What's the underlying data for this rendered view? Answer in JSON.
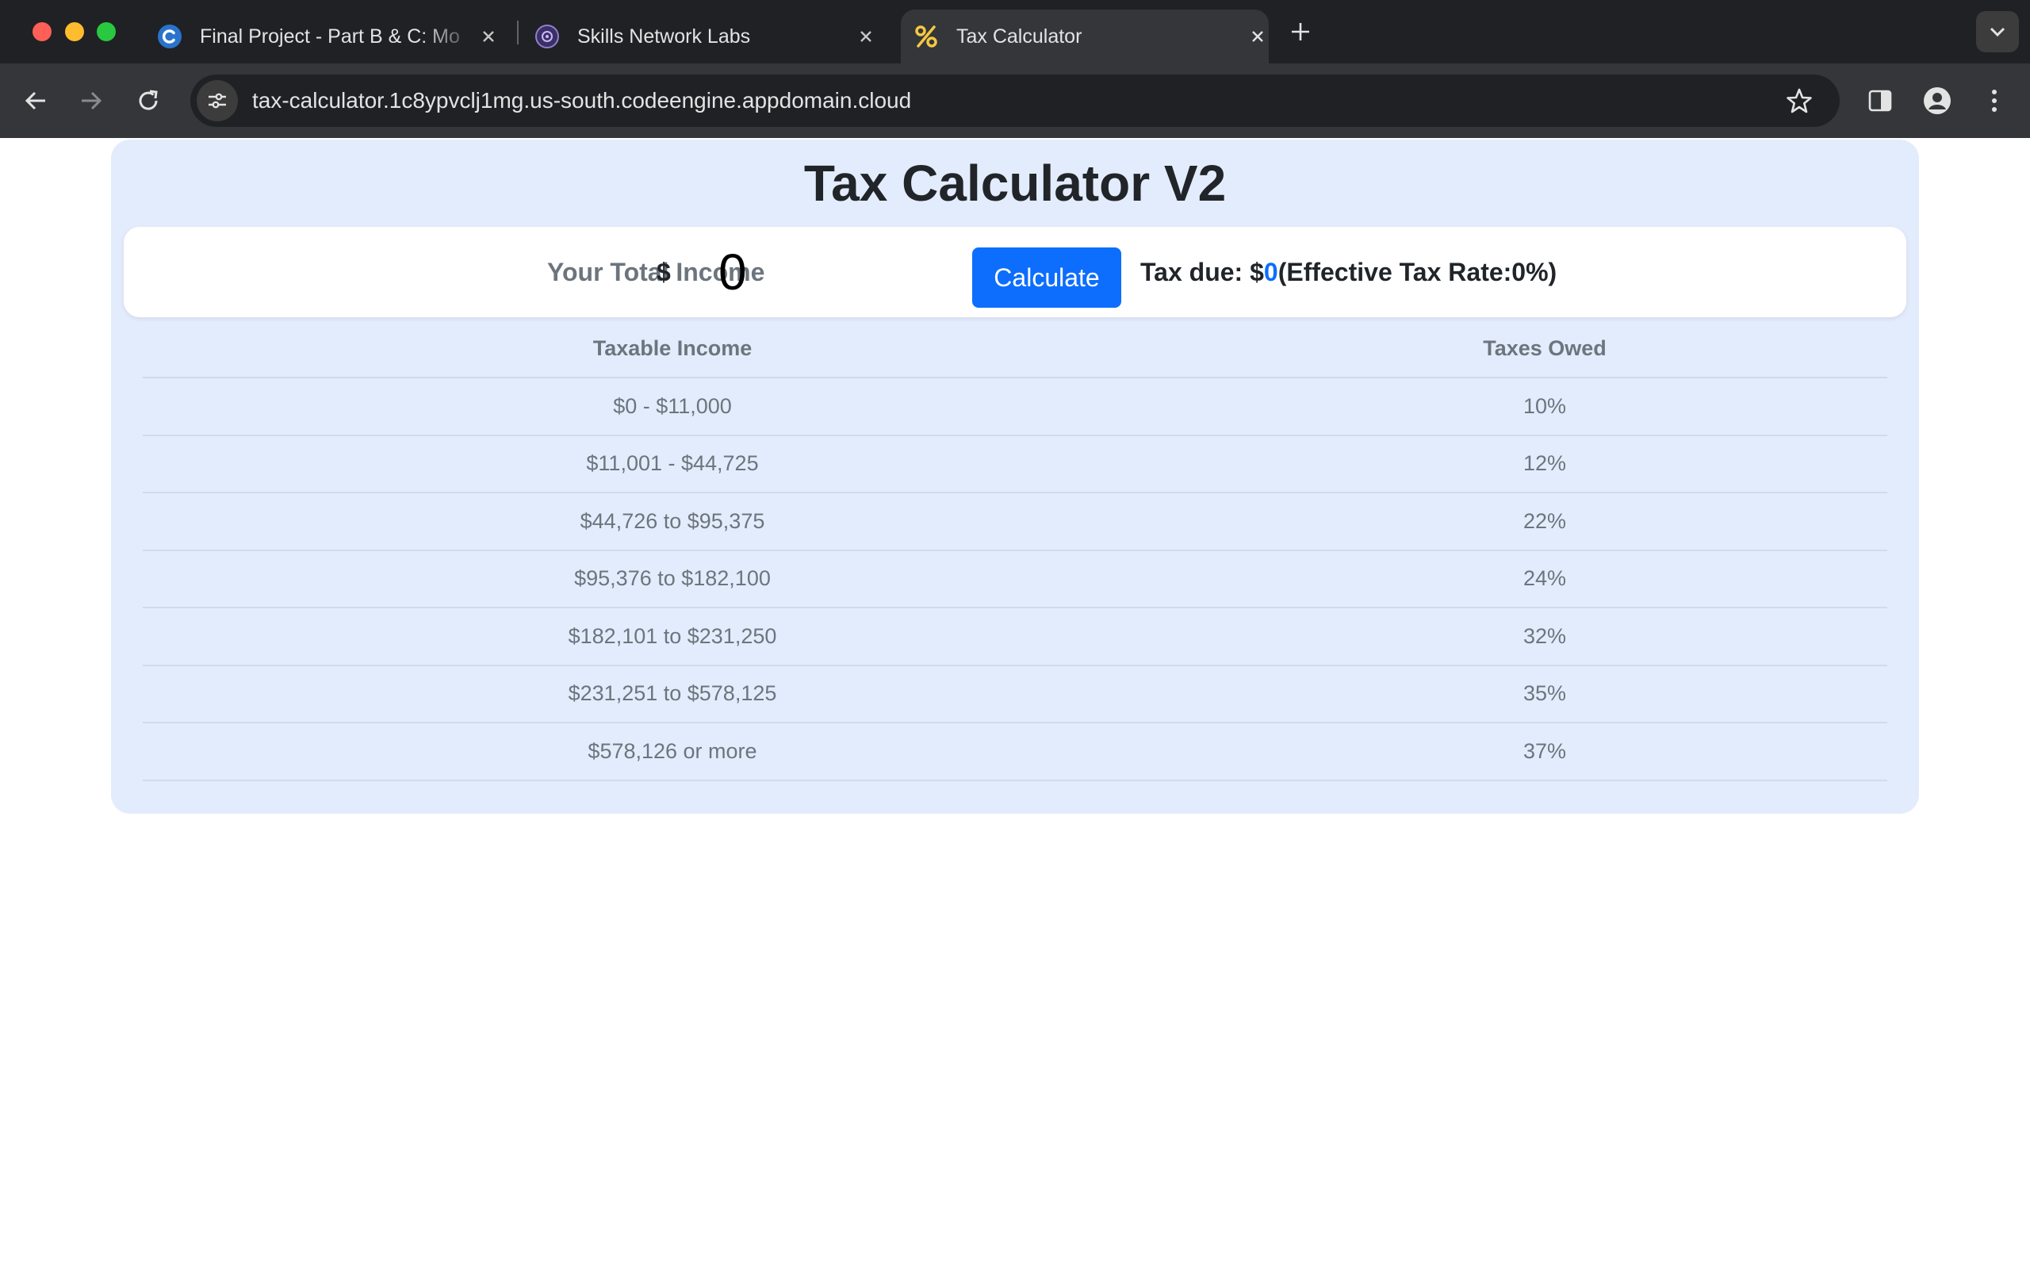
{
  "browser": {
    "tabs": [
      {
        "title": "Final Project - Part B & C: Mo",
        "active": false
      },
      {
        "title": "Skills Network Labs",
        "active": false
      },
      {
        "title": "Tax Calculator",
        "active": true
      }
    ],
    "url": "tax-calculator.1c8ypvclj1mg.us-south.codeengine.appdomain.cloud",
    "icons": [
      "back-icon",
      "forward-icon",
      "reload-icon",
      "site-info-icon",
      "star-icon",
      "side-panel-icon",
      "profile-icon",
      "menu-icon",
      "new-tab-icon",
      "tab-list-icon"
    ]
  },
  "app": {
    "title": "Tax Calculator V2",
    "income_label": "Your Total Income",
    "currency": "$",
    "income_value": "0",
    "calculate_label": "Calculate",
    "tax_due_prefix": "Tax due: $",
    "tax_due_value": "0",
    "rate_prefix": "(Effective Tax Rate:",
    "rate_value": "0%)",
    "accent_color": "#0d6efd",
    "card_color": "#e3ecfc"
  },
  "table": {
    "headers": [
      "Taxable Income",
      "Taxes Owed"
    ],
    "rows": [
      [
        "$0 - $11,000",
        "10%"
      ],
      [
        "$11,001 - $44,725",
        "12%"
      ],
      [
        "$44,726 to $95,375",
        "22%"
      ],
      [
        "$95,376 to $182,100",
        "24%"
      ],
      [
        "$182,101 to $231,250",
        "32%"
      ],
      [
        "$231,251 to $578,125",
        "35%"
      ],
      [
        "$578,126 or more",
        "37%"
      ]
    ]
  }
}
